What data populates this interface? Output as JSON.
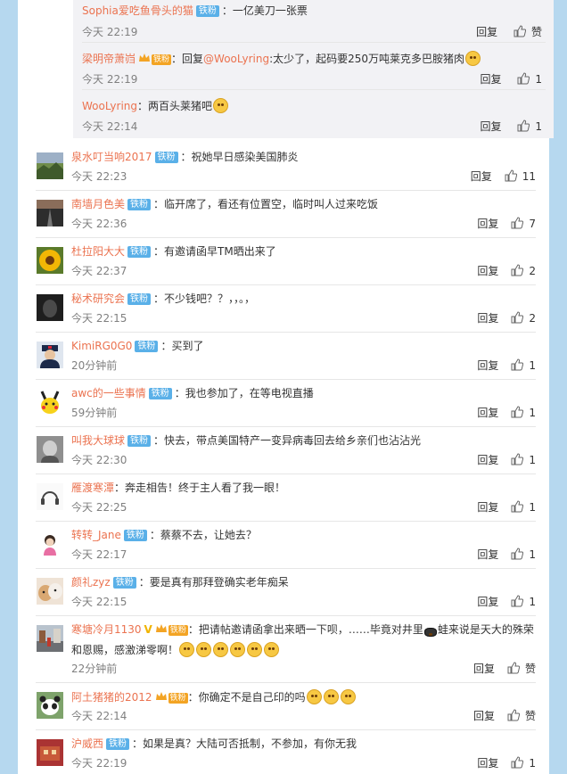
{
  "actions": {
    "reply": "回复",
    "like_default": "赞"
  },
  "badges": {
    "fan": "铁粉",
    "gold_fan": "铁粉"
  },
  "replies": [
    {
      "user": "Sophia爱吃鱼骨头的猫",
      "text": "：一亿美刀一张票",
      "time": "今天 22:19",
      "likes": "赞",
      "badge": "fan"
    },
    {
      "user": "梁明帝萧岿",
      "text_prefix": "：回复",
      "mention": "@WooLyring",
      "text": ":太少了，起码要250万吨莱克多巴胺猪肉",
      "time": "今天 22:19",
      "likes": "1",
      "badge": "gold"
    },
    {
      "user": "WooLyring",
      "text": "：两百头莱猪吧",
      "time": "今天 22:14",
      "likes": "1"
    }
  ],
  "comments": [
    {
      "user": "泉水叮当响2017",
      "text": "：祝她早日感染美国肺炎",
      "time": "今天 22:23",
      "likes": "11",
      "badge": "fan",
      "avatar": "landscape"
    },
    {
      "user": "南墙月色美",
      "text": "：临开席了，看还有位置空，临时叫人过来吃饭",
      "time": "今天 22:36",
      "likes": "7",
      "badge": "fan",
      "avatar": "road"
    },
    {
      "user": "杜拉阳大大",
      "text": "：有邀请函早TM晒出来了",
      "time": "今天 22:37",
      "likes": "2",
      "badge": "fan",
      "avatar": "sunflower"
    },
    {
      "user": "秘术研究会",
      "text": "：不少钱吧？？，，。，",
      "time": "今天 22:15",
      "likes": "2",
      "badge": "fan",
      "avatar": "dark"
    },
    {
      "user": "KimiRG0G0",
      "text": "：买到了",
      "time": "20分钟前",
      "likes": "1",
      "badge": "fan",
      "avatar": "police"
    },
    {
      "user": "awc的一些事情",
      "text": "：我也参加了，在等电视直播",
      "time": "59分钟前",
      "likes": "1",
      "badge": "fan",
      "avatar": "pikachu"
    },
    {
      "user": "叫我大球球",
      "text": "：快去，带点美国特产一变异病毒回去给乡亲们也沾沾光",
      "time": "今天 22:30",
      "likes": "1",
      "badge": "fan",
      "avatar": "grey"
    },
    {
      "user": "雁渡寒潭",
      "text": "：奔走相告！终于主人看了我一眼！",
      "time": "今天 22:25",
      "likes": "1",
      "avatar": "headphone"
    },
    {
      "user": "转转_Jane",
      "text": "：蔡蔡不去，让她去？",
      "time": "今天 22:17",
      "likes": "1",
      "badge": "fan",
      "avatar": "girl"
    },
    {
      "user": "颜礼zyz",
      "text": "：要是真有那拜登确实老年痴呆",
      "time": "今天 22:15",
      "likes": "1",
      "badge": "fan",
      "avatar": "cats"
    },
    {
      "user": "寒塘冷月1130",
      "text": "：把请帖邀请函拿出来晒一下呗，……毕竟对井里",
      "text_cont": "蛙来说是天大的殊荣",
      "text_line2": "和恩赐，感激涕零啊！",
      "time": "22分钟前",
      "likes": "赞",
      "vip": "V",
      "badge": "gold",
      "avatar": "street"
    },
    {
      "user": "阿土猪猪的2012",
      "text": "：你确定不是自己印的吗",
      "time": "今天 22:14",
      "likes": "赞",
      "badge": "gold",
      "avatar": "panda"
    },
    {
      "user": "沪威西",
      "text": "：如果是真？大陆可否抵制，不参加，有你无我",
      "time": "今天 22:19",
      "likes": "1",
      "badge": "fan",
      "avatar": "red"
    }
  ]
}
